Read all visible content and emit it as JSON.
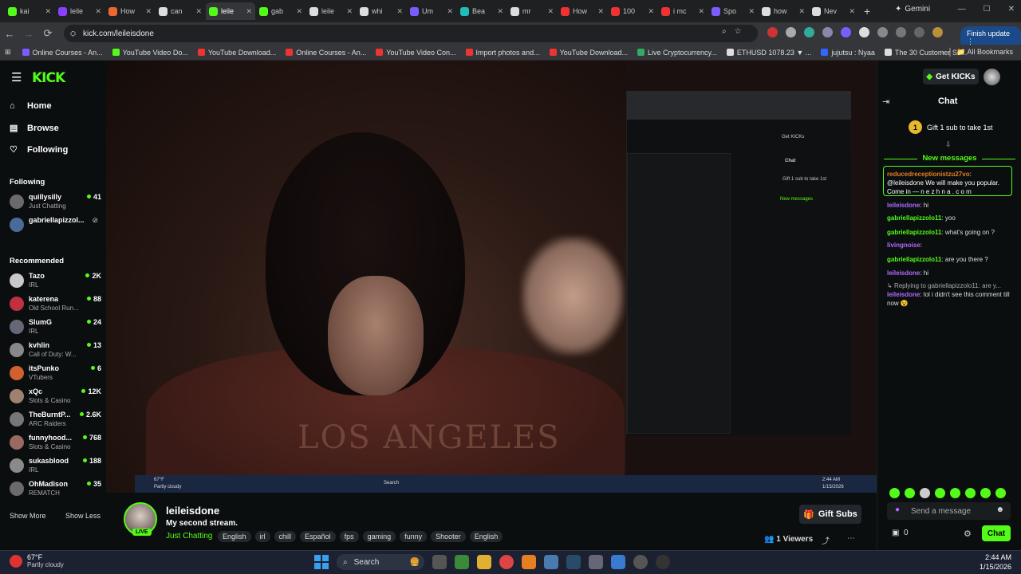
{
  "browser": {
    "tabs": [
      {
        "label": "kai",
        "color": "#53fc18"
      },
      {
        "label": "leile",
        "color": "#8a3ffc"
      },
      {
        "label": "How",
        "color": "#e63"
      },
      {
        "label": "can",
        "color": "#ddd"
      },
      {
        "label": "leile",
        "color": "#53fc18",
        "active": true
      },
      {
        "label": "gab",
        "color": "#53fc18"
      },
      {
        "label": "leile",
        "color": "#ddd"
      },
      {
        "label": "whi",
        "color": "#ddd"
      },
      {
        "label": "Um",
        "color": "#7a5cff"
      },
      {
        "label": "Bea",
        "color": "#2bb"
      },
      {
        "label": "mr",
        "color": "#ddd"
      },
      {
        "label": "How",
        "color": "#e33"
      },
      {
        "label": "100",
        "color": "#e33"
      },
      {
        "label": "i mc",
        "color": "#e33"
      },
      {
        "label": "Spo",
        "color": "#7a5cff"
      },
      {
        "label": "how",
        "color": "#ddd"
      },
      {
        "label": "Nev",
        "color": "#ddd"
      }
    ],
    "gemini_label": "Gemini",
    "url": "kick.com/leileisdone",
    "finish_update": "Finish update",
    "bookmarks": [
      {
        "label": "Online Courses - An...",
        "color": "#7a5cff"
      },
      {
        "label": "YouTube Video Do...",
        "color": "#53fc18"
      },
      {
        "label": "YouTube Download...",
        "color": "#e33"
      },
      {
        "label": "Online Courses - An...",
        "color": "#e33"
      },
      {
        "label": "YouTube Video Con...",
        "color": "#e33"
      },
      {
        "label": "Import photos and...",
        "color": "#e33"
      },
      {
        "label": "YouTube Download...",
        "color": "#e33"
      },
      {
        "label": "Live Cryptocurrency...",
        "color": "#3a6"
      },
      {
        "label": "ETHUSD 1078.23 ▼ ...",
        "color": "#ddd"
      },
      {
        "label": "jujutsu : Nyaa",
        "color": "#36f"
      },
      {
        "label": "The 30 Customer Se...",
        "color": "#ddd"
      }
    ],
    "all_bookmarks": "All Bookmarks"
  },
  "nav": {
    "home": "Home",
    "browse": "Browse",
    "following": "Following"
  },
  "following_section": {
    "title": "Following",
    "channels": [
      {
        "name": "quillysilly",
        "category": "Just Chatting",
        "viewers": "41"
      },
      {
        "name": "gabriellapizzol...",
        "category": "",
        "viewers": ""
      }
    ]
  },
  "recommended_section": {
    "title": "Recommended",
    "channels": [
      {
        "name": "Tazo",
        "category": "IRL",
        "viewers": "2K"
      },
      {
        "name": "katerena",
        "category": "Old School Run...",
        "viewers": "88"
      },
      {
        "name": "SlumG",
        "category": "IRL",
        "viewers": "24"
      },
      {
        "name": "kvhlin",
        "category": "Call of Duty: W...",
        "viewers": "13"
      },
      {
        "name": "itsPunko",
        "category": "VTubers",
        "viewers": "6"
      },
      {
        "name": "xQc",
        "category": "Slots & Casino",
        "viewers": "12K"
      },
      {
        "name": "TheBurntP...",
        "category": "ARC Raiders",
        "viewers": "2.6K"
      },
      {
        "name": "funnyhood...",
        "category": "Slots & Casino",
        "viewers": "768"
      },
      {
        "name": "sukasblood",
        "category": "IRL",
        "viewers": "188"
      },
      {
        "name": "OhMadison",
        "category": "REMATCH",
        "viewers": "35"
      }
    ],
    "show_more": "Show More",
    "show_less": "Show Less"
  },
  "stream": {
    "channel": "leileisdone",
    "title": "My second stream.",
    "category": "Just Chatting",
    "live_label": "LIVE",
    "tags": [
      "English",
      "irl",
      "chill",
      "Español",
      "fps",
      "gaming",
      "funny",
      "Shooter",
      "English"
    ],
    "gift_subs": "Gift Subs",
    "viewers": "1 Viewers"
  },
  "screen": {
    "shirt_text": "LOS ANGELES"
  },
  "header": {
    "get_kicks": "Get KICKs"
  },
  "chat": {
    "title": "Chat",
    "gift_banner": "Gift 1 sub to take 1st",
    "new_messages": "New messages",
    "highlight_user": "reducedreceptionistzu27vo",
    "highlight_text": ": @leileisdone We will make you popular. Come in — n e z h n a . c o m",
    "messages": [
      {
        "user": "leileisdone",
        "text": ": hi",
        "color": "#b06aff"
      },
      {
        "user": "gabriellapizzolo11",
        "text": ": yoo",
        "color": "#53fc18"
      },
      {
        "user": "gabriellapizzolo11",
        "text": ": what's going on ?",
        "color": "#53fc18"
      },
      {
        "user": "livingnoise",
        "text": ": ",
        "color": "#b06aff"
      },
      {
        "user": "gabriellapizzolo11",
        "text": ": are you there ?",
        "color": "#53fc18"
      },
      {
        "user": "leileisdone",
        "text": ": hi",
        "color": "#b06aff"
      }
    ],
    "reply_hint": "Replying to gabriellapizzolo11: are y...",
    "last_user": "leileisdone",
    "last_text": ": lol i didn't see this comment till now 😵",
    "send_placeholder": "Send a message",
    "points": "0",
    "chat_button": "Chat"
  },
  "taskbar": {
    "temp": "67°F",
    "weather": "Partly cloudy",
    "search": "Search",
    "time": "2:44 AM",
    "date": "1/15/2026"
  }
}
